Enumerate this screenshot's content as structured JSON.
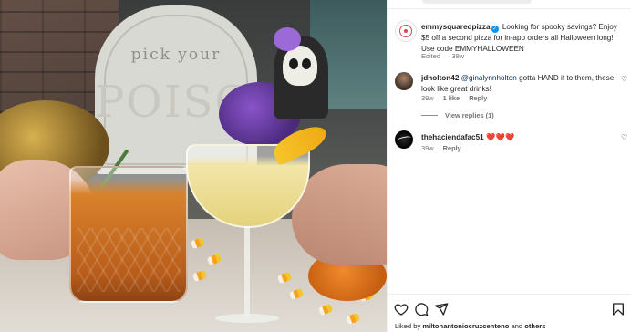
{
  "post": {
    "author": "emmysquaredpizza",
    "caption": "Looking for spooky savings? Enjoy $5 off a second pizza for in-app orders all Halloween long! Use code EMMYHALLOWEEN",
    "edited_label": "Edited",
    "time": "39w"
  },
  "comments": [
    {
      "username": "jdholton42",
      "mention": "@ginalynnholton",
      "text": "gotta HAND it to them, these look like great drinks!",
      "time": "39w",
      "likes": "1 like",
      "reply_label": "Reply",
      "view_replies": "View replies (1)"
    },
    {
      "username": "thehaciendafac51",
      "text": "❤️❤️❤️",
      "time": "39w",
      "reply_label": "Reply"
    }
  ],
  "photo": {
    "tombstone_line1": "pick your",
    "tombstone_line2": "POISON"
  },
  "footer": {
    "liked_by_prefix": "Liked by",
    "liked_by_user": "miltonantoniocruzcenteno",
    "liked_by_suffix": "and",
    "liked_by_others": "others"
  },
  "icons": {
    "like": "heart-outline-icon",
    "comment": "comment-bubble-icon",
    "share": "paper-plane-icon",
    "save": "bookmark-icon",
    "verified": "verified-badge-icon"
  },
  "colors": {
    "link": "#00376b",
    "meta": "#737373",
    "verified": "#0095f6",
    "hearts": "#ed4956"
  }
}
